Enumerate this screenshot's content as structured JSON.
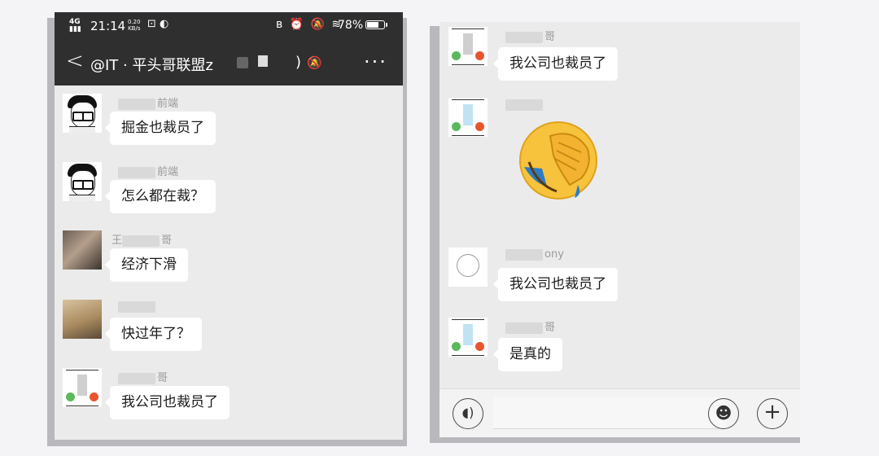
{
  "left_screen": {
    "status_bar": {
      "network": "4G",
      "time": "21:14",
      "speed_value": "0.20",
      "speed_unit": "KB/s",
      "battery_percent": "78%",
      "battery_level": 0.78
    },
    "header": {
      "title": "@IT · 平头哥联盟",
      "title_tail": "z",
      "close_paren": ")"
    },
    "messages": [
      {
        "sender": "前端",
        "text": "掘金也裁员了"
      },
      {
        "sender": "前端",
        "text": "怎么都在裁？"
      },
      {
        "sender": "王",
        "sender_tail": "哥",
        "text": "经济下滑"
      },
      {
        "sender": "",
        "text": "快过年了？"
      },
      {
        "sender": "哥",
        "text": "我公司也裁员了"
      }
    ]
  },
  "right_screen": {
    "messages": [
      {
        "sender": "哥",
        "text": "我公司也裁员了"
      },
      {
        "sender": "",
        "content": "facepalm-emoji"
      },
      {
        "sender": "ony",
        "text": "我公司也裁员了"
      },
      {
        "sender": "哥",
        "text": "是真的"
      }
    ],
    "input_bar": {
      "voice_icon": "voice-icon",
      "emoji_icon": "smiley-icon",
      "plus_icon": "plus-icon"
    }
  },
  "colors": {
    "header_bg": "#2f2f2f",
    "chat_bg": "#ebebeb",
    "bubble_bg": "#ffffff",
    "name_text": "#9a9a9a"
  }
}
